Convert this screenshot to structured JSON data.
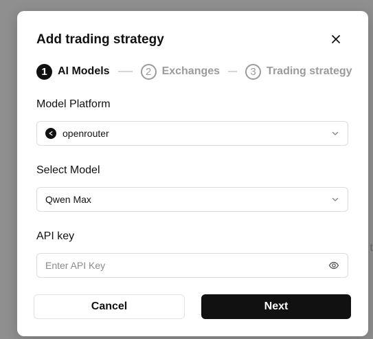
{
  "dialog": {
    "title": "Add trading strategy"
  },
  "steps": [
    {
      "number": "1",
      "label": "AI Models",
      "active": true
    },
    {
      "number": "2",
      "label": "Exchanges",
      "active": false
    },
    {
      "number": "3",
      "label": "Trading strategy",
      "active": false
    }
  ],
  "form": {
    "platform": {
      "label": "Model Platform",
      "value": "openrouter"
    },
    "model": {
      "label": "Select Model",
      "value": "Qwen Max"
    },
    "api_key": {
      "label": "API key",
      "placeholder": "Enter API Key",
      "value": ""
    }
  },
  "actions": {
    "cancel_label": "Cancel",
    "next_label": "Next"
  },
  "background": {
    "partial_text": "t"
  },
  "icons": {
    "close": "close-icon",
    "platform": "openrouter-logo-icon",
    "dropdown": "chevron-down-icon",
    "visibility": "eye-icon"
  },
  "colors": {
    "primary": "#111111",
    "muted": "#9b9b9b",
    "border": "#dcdcdc"
  }
}
